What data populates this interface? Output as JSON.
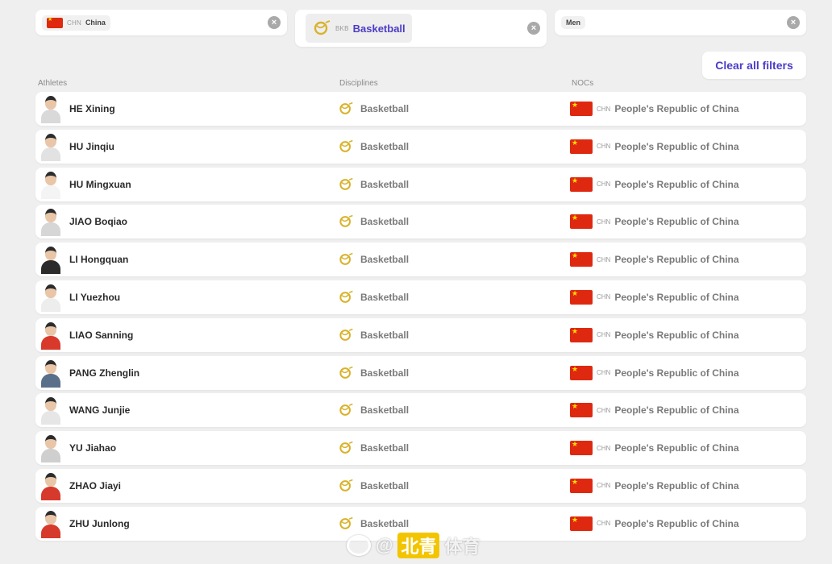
{
  "colors": {
    "accent": "#4b3cc6",
    "flag_red": "#de2910",
    "flag_star": "#ffde00",
    "basketball_icon": "#d8b22a",
    "watermark_highlight": "#f2c500"
  },
  "filters": {
    "noc": {
      "code": "CHN",
      "label": "China",
      "icon": "china-flag-icon"
    },
    "discipline": {
      "code": "BKB",
      "label": "Basketball",
      "icon": "basketball-icon"
    },
    "gender": {
      "label": "Men"
    },
    "clear_icon": "×"
  },
  "clear_all_label": "Clear all filters",
  "columns": {
    "athletes": "Athletes",
    "disciplines": "Disciplines",
    "nocs": "NOCs"
  },
  "athletes": [
    {
      "name": "HE Xining",
      "discipline": "Basketball",
      "noc_code": "CHN",
      "noc_name": "People's Republic of China",
      "jersey": "#d9d9d9"
    },
    {
      "name": "HU Jinqiu",
      "discipline": "Basketball",
      "noc_code": "CHN",
      "noc_name": "People's Republic of China",
      "jersey": "#e2e2e2"
    },
    {
      "name": "HU Mingxuan",
      "discipline": "Basketball",
      "noc_code": "CHN",
      "noc_name": "People's Republic of China",
      "jersey": "#f4f4f4"
    },
    {
      "name": "JIAO Boqiao",
      "discipline": "Basketball",
      "noc_code": "CHN",
      "noc_name": "People's Republic of China",
      "jersey": "#d6d6d6"
    },
    {
      "name": "LI Hongquan",
      "discipline": "Basketball",
      "noc_code": "CHN",
      "noc_name": "People's Republic of China",
      "jersey": "#2b2b2b"
    },
    {
      "name": "LI Yuezhou",
      "discipline": "Basketball",
      "noc_code": "CHN",
      "noc_name": "People's Republic of China",
      "jersey": "#ededed"
    },
    {
      "name": "LIAO Sanning",
      "discipline": "Basketball",
      "noc_code": "CHN",
      "noc_name": "People's Republic of China",
      "jersey": "#d8392b"
    },
    {
      "name": "PANG Zhenglin",
      "discipline": "Basketball",
      "noc_code": "CHN",
      "noc_name": "People's Republic of China",
      "jersey": "#5a6f8a"
    },
    {
      "name": "WANG Junjie",
      "discipline": "Basketball",
      "noc_code": "CHN",
      "noc_name": "People's Republic of China",
      "jersey": "#e6e6e6"
    },
    {
      "name": "YU Jiahao",
      "discipline": "Basketball",
      "noc_code": "CHN",
      "noc_name": "People's Republic of China",
      "jersey": "#cfcfcf"
    },
    {
      "name": "ZHAO Jiayi",
      "discipline": "Basketball",
      "noc_code": "CHN",
      "noc_name": "People's Republic of China",
      "jersey": "#d63a2c"
    },
    {
      "name": "ZHU Junlong",
      "discipline": "Basketball",
      "noc_code": "CHN",
      "noc_name": "People's Republic of China",
      "jersey": "#d63a2c"
    }
  ],
  "watermark": {
    "prefix": "@",
    "highlight": "北青",
    "suffix": "体育"
  }
}
